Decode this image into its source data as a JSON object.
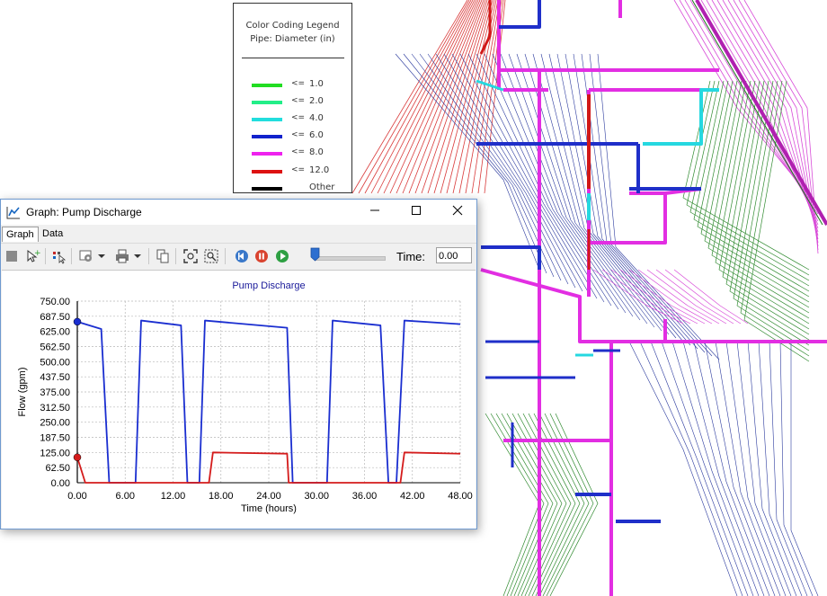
{
  "legend": {
    "title": "Color Coding Legend",
    "subtitle": "Pipe: Diameter (in)",
    "items": [
      {
        "op": "<=",
        "value": "1.0",
        "color": "#22dd22"
      },
      {
        "op": "<=",
        "value": "2.0",
        "color": "#22ee88"
      },
      {
        "op": "<=",
        "value": "4.0",
        "color": "#22dddd"
      },
      {
        "op": "<=",
        "value": "6.0",
        "color": "#1122cc"
      },
      {
        "op": "<=",
        "value": "8.0",
        "color": "#ee22ee"
      },
      {
        "op": "<=",
        "value": "12.0",
        "color": "#dd1111"
      },
      {
        "op": "",
        "value": "Other",
        "color": "#000000"
      }
    ]
  },
  "window": {
    "title": "Graph: Pump Discharge",
    "tabs": [
      "Graph",
      "Data"
    ],
    "active_tab": "Graph",
    "time_label": "Time:",
    "time_value": "0.00"
  },
  "chart_data": {
    "type": "line",
    "title": "Pump Discharge",
    "xlabel": "Time (hours)",
    "ylabel": "Flow (gpm)",
    "xlim": [
      0,
      48
    ],
    "ylim": [
      0,
      750
    ],
    "x_ticks": [
      "0.00",
      "6.00",
      "12.00",
      "18.00",
      "24.00",
      "30.00",
      "36.00",
      "42.00",
      "48.00"
    ],
    "y_ticks": [
      "750.00",
      "687.50",
      "625.00",
      "562.50",
      "500.00",
      "437.50",
      "375.00",
      "312.50",
      "250.00",
      "187.50",
      "125.00",
      "62.50",
      "0.00"
    ],
    "grid": true,
    "series": [
      {
        "color": "#1a2ed0",
        "x": [
          0,
          3,
          4,
          7.3,
          8,
          13,
          13.8,
          15.3,
          16,
          26.3,
          27,
          31.3,
          32,
          38,
          39,
          40,
          41,
          48
        ],
        "y": [
          665,
          635,
          0,
          0,
          670,
          650,
          0,
          0,
          670,
          640,
          0,
          0,
          670,
          650,
          0,
          0,
          670,
          655
        ]
      },
      {
        "color": "#d41b1b",
        "x": [
          0,
          1,
          16.5,
          17,
          26.3,
          26.5,
          40.5,
          41,
          48
        ],
        "y": [
          105,
          0,
          0,
          125,
          120,
          0,
          0,
          125,
          120
        ]
      }
    ]
  }
}
